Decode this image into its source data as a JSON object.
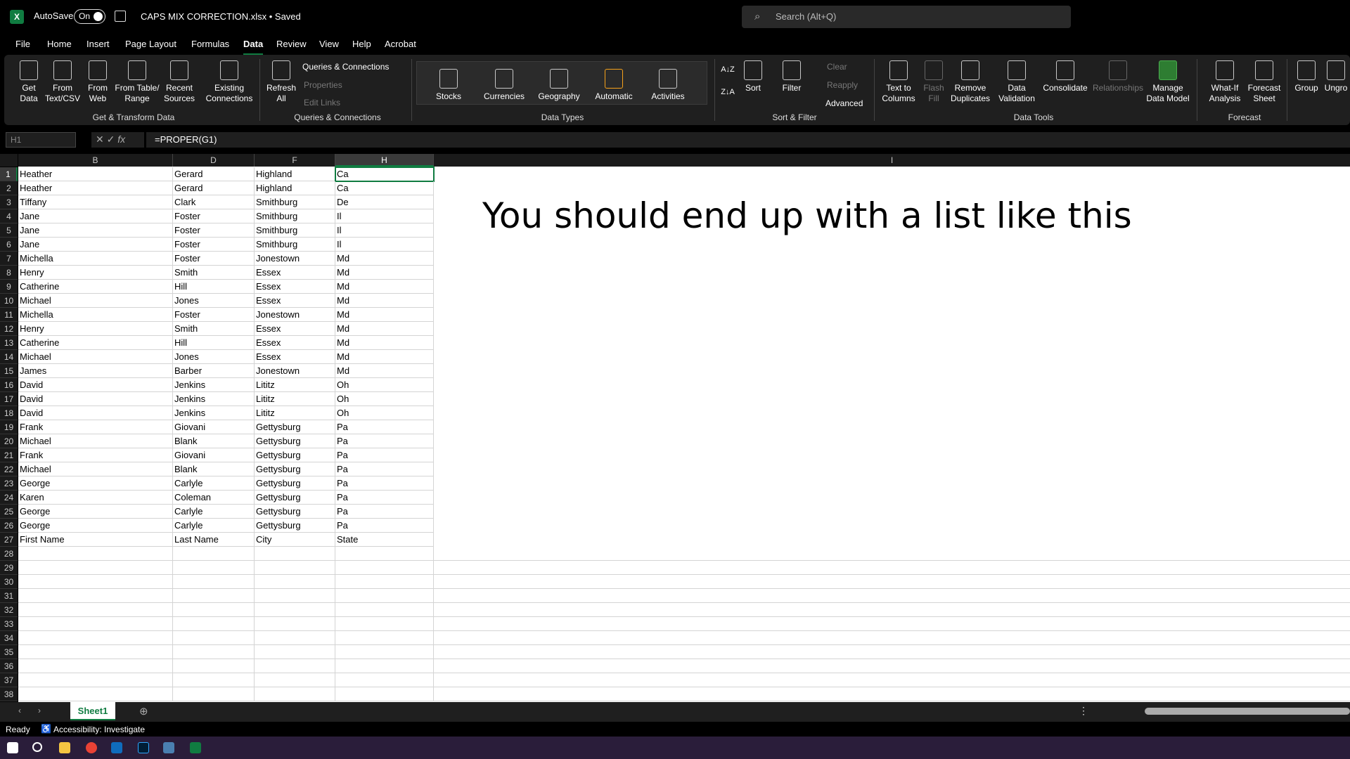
{
  "titlebar": {
    "app_icon": "X",
    "autosave_label": "AutoSave",
    "toggle_label": "On",
    "filename": "CAPS MIX CORRECTION.xlsx • Saved",
    "search_placeholder": "Search (Alt+Q)"
  },
  "tabs": [
    "File",
    "Home",
    "Insert",
    "Page Layout",
    "Formulas",
    "Data",
    "Review",
    "View",
    "Help",
    "Acrobat"
  ],
  "ribbon": {
    "get_data": "Get Data",
    "from_text_csv": "From Text/CSV",
    "from_web": "From Web",
    "from_table_range": "From Table/ Range",
    "recent_sources": "Recent Sources",
    "existing_connections": "Existing Connections",
    "group_get_transform": "Get & Transform Data",
    "refresh_all": "Refresh All",
    "queries_connections": "Queries & Connections",
    "properties": "Properties",
    "edit_links": "Edit Links",
    "group_queries": "Queries & Connections",
    "stocks": "Stocks",
    "currencies": "Currencies",
    "geography": "Geography",
    "automatic": "Automatic",
    "activities": "Activities",
    "group_data_types": "Data Types",
    "sort": "Sort",
    "filter": "Filter",
    "clear": "Clear",
    "reapply": "Reapply",
    "advanced": "Advanced",
    "group_sort_filter": "Sort & Filter",
    "text_to_columns": "Text to Columns",
    "flash_fill": "Flash Fill",
    "remove_duplicates": "Remove Duplicates",
    "data_validation": "Data Validation",
    "consolidate": "Consolidate",
    "relationships": "Relationships",
    "manage_data_model": "Manage Data Model",
    "group_data_tools": "Data Tools",
    "what_if": "What-If Analysis",
    "forecast_sheet": "Forecast Sheet",
    "group_forecast": "Forecast",
    "group": "Group",
    "ungroup": "Ungro"
  },
  "formula_bar": {
    "name_box": "H1",
    "formula": "=PROPER(G1)"
  },
  "columns": [
    "B",
    "D",
    "F",
    "H",
    "I"
  ],
  "rows": [
    [
      "Heather",
      "Gerard",
      "Highland",
      "Ca"
    ],
    [
      "Heather",
      "Gerard",
      "Highland",
      "Ca"
    ],
    [
      "Tiffany",
      "Clark",
      "Smithburg",
      "De"
    ],
    [
      "Jane",
      "Foster",
      "Smithburg",
      "Il"
    ],
    [
      "Jane",
      "Foster",
      "Smithburg",
      "Il"
    ],
    [
      "Jane",
      "Foster",
      "Smithburg",
      "Il"
    ],
    [
      "Michella",
      "Foster",
      "Jonestown",
      "Md"
    ],
    [
      "Henry",
      "Smith",
      "Essex",
      "Md"
    ],
    [
      "Catherine",
      "Hill",
      "Essex",
      "Md"
    ],
    [
      "Michael",
      "Jones",
      "Essex",
      "Md"
    ],
    [
      "Michella",
      "Foster",
      "Jonestown",
      "Md"
    ],
    [
      "Henry",
      "Smith",
      "Essex",
      "Md"
    ],
    [
      "Catherine",
      "Hill",
      "Essex",
      "Md"
    ],
    [
      "Michael",
      "Jones",
      "Essex",
      "Md"
    ],
    [
      "James",
      "Barber",
      "Jonestown",
      "Md"
    ],
    [
      "David",
      "Jenkins",
      "Lititz",
      "Oh"
    ],
    [
      "David",
      "Jenkins",
      "Lititz",
      "Oh"
    ],
    [
      "David",
      "Jenkins",
      "Lititz",
      "Oh"
    ],
    [
      "Frank",
      "Giovani",
      "Gettysburg",
      "Pa"
    ],
    [
      "Michael",
      "Blank",
      "Gettysburg",
      "Pa"
    ],
    [
      "Frank",
      "Giovani",
      "Gettysburg",
      "Pa"
    ],
    [
      "Michael",
      "Blank",
      "Gettysburg",
      "Pa"
    ],
    [
      "George",
      "Carlyle",
      "Gettysburg",
      "Pa"
    ],
    [
      "Karen",
      "Coleman",
      "Gettysburg",
      "Pa"
    ],
    [
      "George",
      "Carlyle",
      "Gettysburg",
      "Pa"
    ],
    [
      "George",
      "Carlyle",
      "Gettysburg",
      "Pa"
    ],
    [
      "First Name",
      "Last Name",
      "City",
      "State"
    ]
  ],
  "row_count": 38,
  "overlay_text": "You should end up with a list like this",
  "sheet_tab": "Sheet1",
  "status": {
    "ready": "Ready",
    "accessibility": "Accessibility: Investigate"
  },
  "colors": {
    "accent": "#107c41",
    "taskbar": "#2a1d3a"
  }
}
